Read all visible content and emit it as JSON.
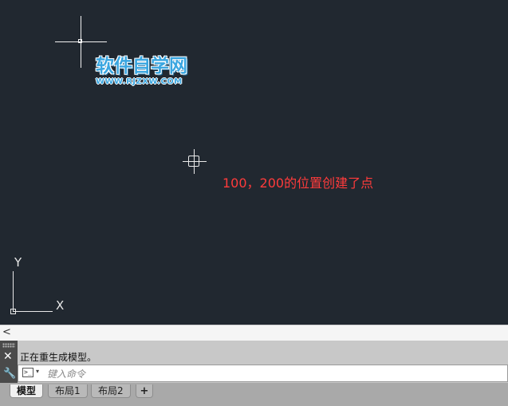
{
  "watermark": {
    "main": "软件自学网",
    "sub": "WWW.RJZXW.COM"
  },
  "annotation": "100，200的位置创建了点",
  "ucs": {
    "x_label": "X",
    "y_label": "Y"
  },
  "scroll": {
    "left_arrow": "<"
  },
  "command": {
    "history": "正在重生成模型。",
    "placeholder": "键入命令",
    "prompt_icon": ">_",
    "prompt_caret": "▾",
    "close_glyph": "✕",
    "wrench_glyph": "🔧"
  },
  "tabs": [
    {
      "label": "模型",
      "active": true
    },
    {
      "label": "布局1",
      "active": false
    },
    {
      "label": "布局2",
      "active": false
    }
  ],
  "tab_add": "+",
  "colors": {
    "canvas": "#212830",
    "annotation": "#ff3b3b",
    "watermark": "#3aa6e0"
  }
}
